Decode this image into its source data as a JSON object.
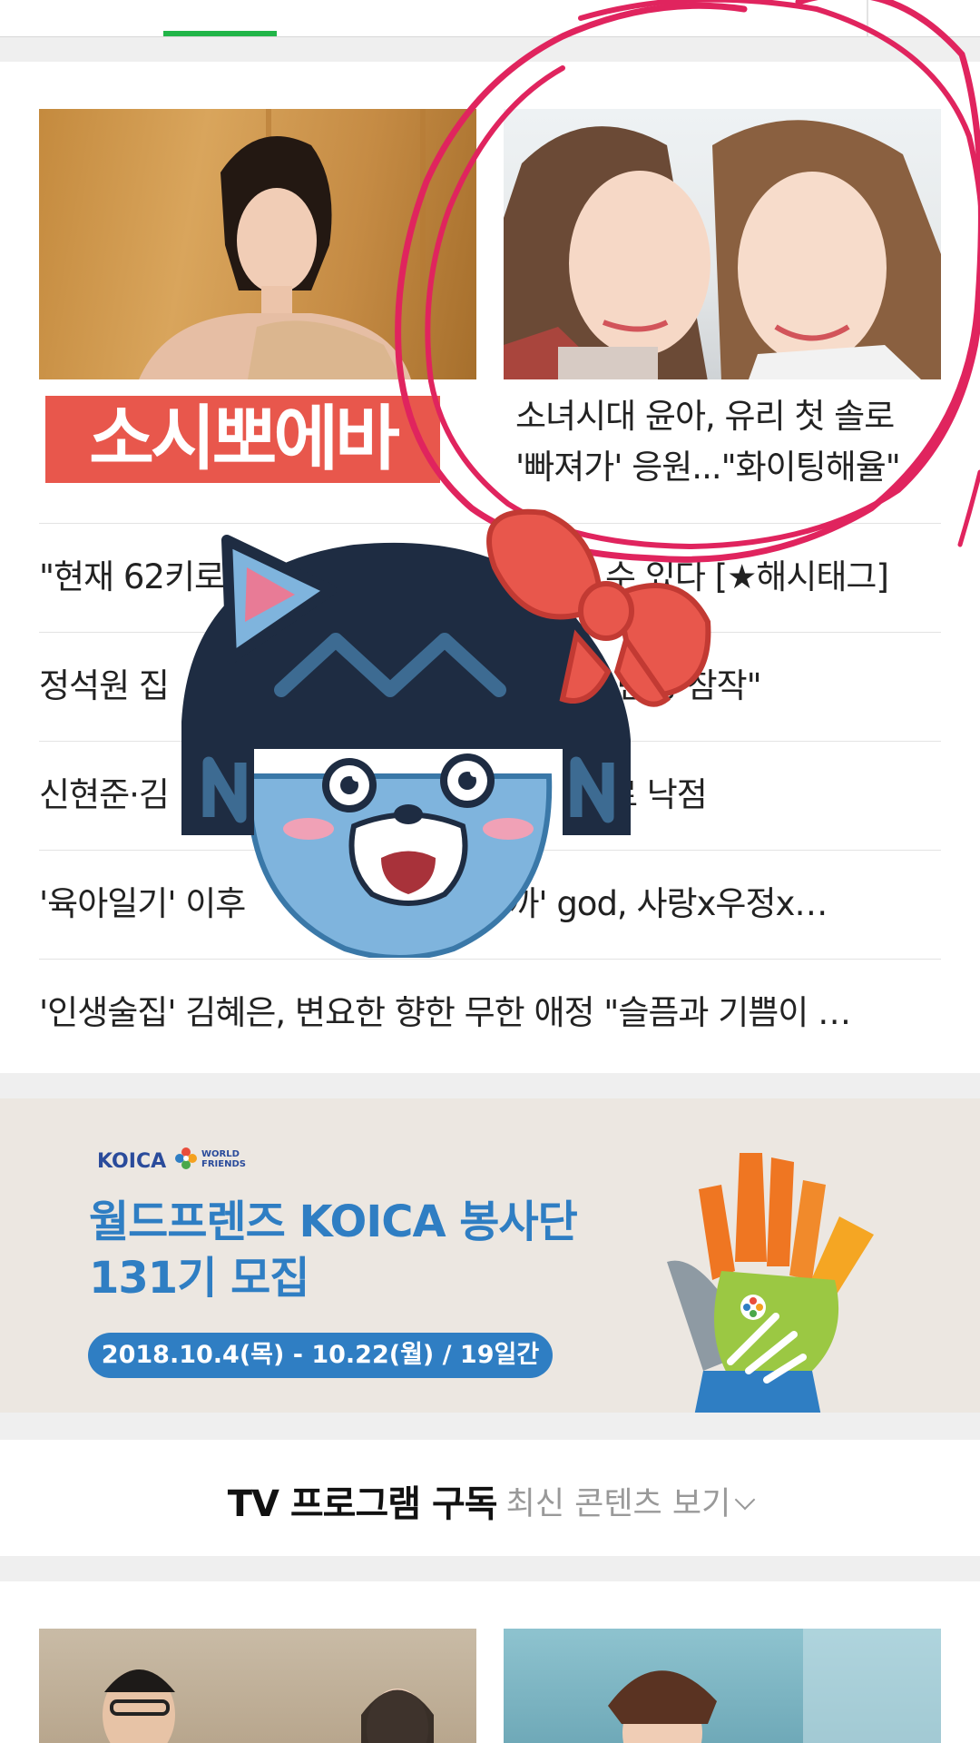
{
  "colors": {
    "tab_active": "#21b548",
    "annotation": "#e0245e",
    "ad_blue": "#2f7ec3",
    "sticker_red": "#e8574c"
  },
  "news": {
    "left_caption_text": "소시뽀에바",
    "right_caption": "소녀시대 윤아, 유리 첫 솔로 '빠져가' 응원...\"화이팅해율\"",
    "headlines": [
      "\"현재 62키로",
      "정석원 집",
      "신현준·김",
      "'육아일기' 이후",
      "'인생술집' 김혜은, 변요한 향한 무한 애정 \"슬픔과 기쁨이 …"
    ],
    "headline_tails": [
      "수 있다 [★해시태그]",
      "고 반성 참작\"",
      "자로 낙점",
      "까' god, 사랑x우정x…",
      ""
    ]
  },
  "ad": {
    "logo": "KOICA",
    "logo_sub": "WORLD FRIENDS",
    "title_line1": "월드프렌즈 KOICA 봉사단",
    "title_line2": "131기 모집",
    "period": "2018.10.4(목) - 10.22(월) / 19일간"
  },
  "tv": {
    "title": "TV 프로그램 구독",
    "link": "최신 콘텐츠 보기"
  },
  "sticker": {
    "icon": "cat-mascot-with-bow-icon"
  }
}
